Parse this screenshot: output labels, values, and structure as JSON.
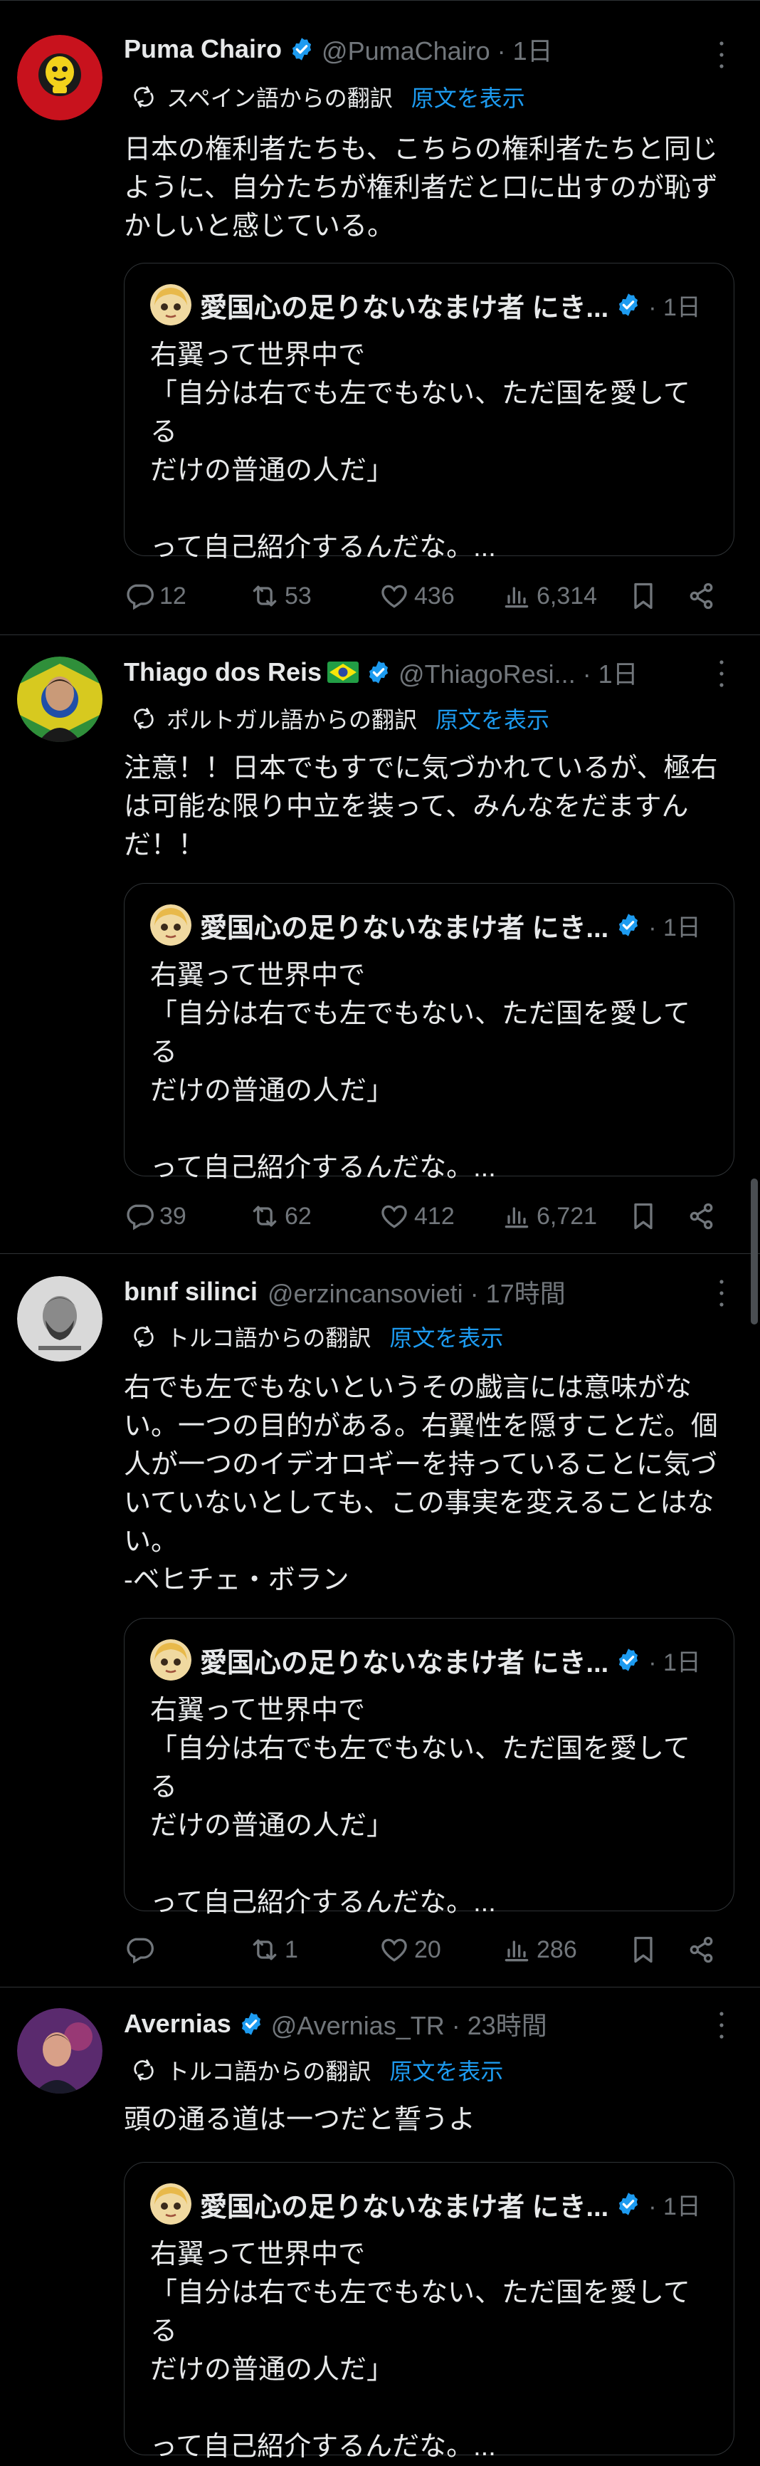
{
  "tweets": [
    {
      "name": "Puma Chairo",
      "handle": "@PumaChairo · 1日",
      "verified": true,
      "translation": {
        "label": "スペイン語からの翻訳",
        "link": "原文を表示"
      },
      "text": "日本の権利者たちも、こちらの権利者たちと同じ\nように、自分たちが権利者だと口に出すのが恥ず\nかしいと感じている。",
      "quote": {
        "name": "愛国心の足りないなまけ者 にき...",
        "time": "· 1日",
        "text": "右翼って世界中で\n「自分は右でも左でもない、ただ国を愛してる\nだけの普通の人だ」\n\nって自己紹介するんだな。..."
      },
      "actions": {
        "replies": "12",
        "retweets": "53",
        "likes": "436",
        "views": "6,314"
      }
    },
    {
      "name": "Thiago dos Reis",
      "handle": "@ThiagoResi... · 1日",
      "verified": true,
      "flag": "brazil-flag",
      "translation": {
        "label": "ポルトガル語からの翻訳",
        "link": "原文を表示"
      },
      "text": "注意！！日本でもすでに気づかれているが、極右\nは可能な限り中立を装って、みんなをだますん\nだ！！",
      "quote": {
        "name": "愛国心の足りないなまけ者 にき...",
        "time": "· 1日",
        "text": "右翼って世界中で\n「自分は右でも左でもない、ただ国を愛してる\nだけの普通の人だ」\n\nって自己紹介するんだな。..."
      },
      "actions": {
        "replies": "39",
        "retweets": "62",
        "likes": "412",
        "views": "6,721"
      }
    },
    {
      "name": "bınıf silinci",
      "handle": "@erzincansovieti · 17時間",
      "verified": false,
      "translation": {
        "label": "トルコ語からの翻訳",
        "link": "原文を表示"
      },
      "text": "右でも左でもないというその戯言には意味がな\nい。一つの目的がある。右翼性を隠すことだ。個\n人が一つのイデオロギーを持っていることに気づ\nいていないとしても、この事実を変えることはな\nい。\n-ベヒチェ・ボラン",
      "quote": {
        "name": "愛国心の足りないなまけ者 にき...",
        "time": "· 1日",
        "text": "右翼って世界中で\n「自分は右でも左でもない、ただ国を愛してる\nだけの普通の人だ」\n\nって自己紹介するんだな。..."
      },
      "actions": {
        "replies": "",
        "retweets": "1",
        "likes": "20",
        "views": "286"
      }
    },
    {
      "name": "Avernias",
      "handle": "@Avernias_TR · 23時間",
      "verified": true,
      "translation": {
        "label": "トルコ語からの翻訳",
        "link": "原文を表示"
      },
      "text": "頭の通る道は一つだと誓うよ",
      "quote": {
        "name": "愛国心の足りないなまけ者 にき...",
        "time": "· 1日",
        "text": "右翼って世界中で\n「自分は右でも左でもない、ただ国を愛してる\nだけの普通の人だ」\n\nって自己紹介するんだな。..."
      }
    }
  ],
  "colors": {
    "background": "#000000",
    "text": "#e7e9ea",
    "muted": "#71767b",
    "accent": "#1d9bf0",
    "border": "#2f3336"
  }
}
